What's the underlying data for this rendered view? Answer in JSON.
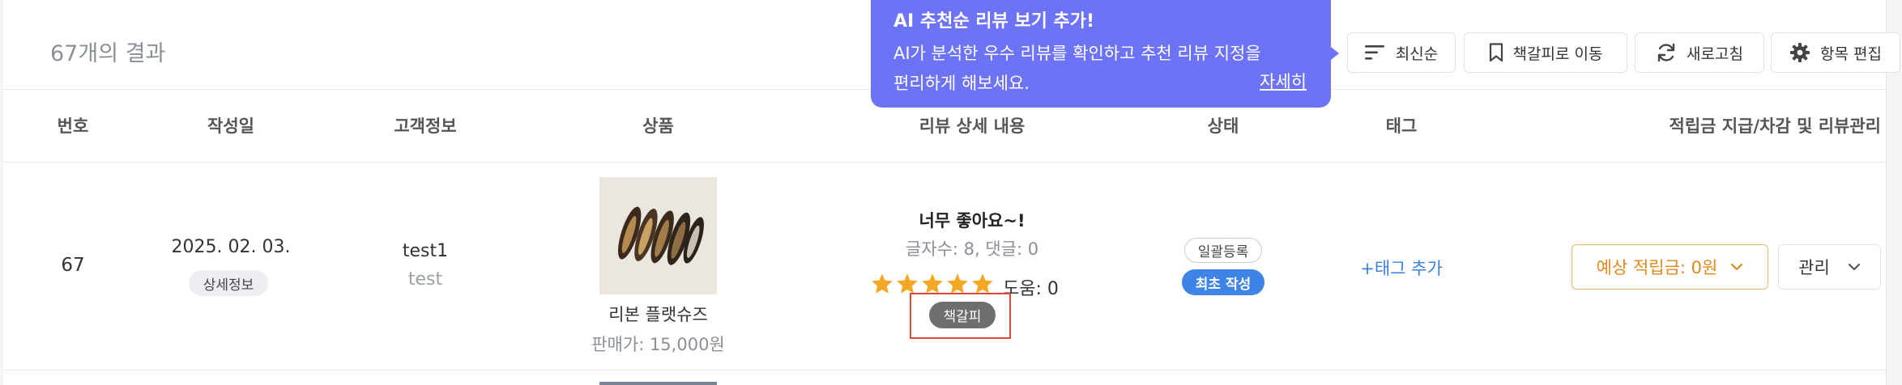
{
  "result_count": "67개의 결과",
  "tooltip": {
    "title": "AI 추천순 리뷰 보기 추가!",
    "body_line1": "AI가 분석한 우수 리뷰를 확인하고 추천 리뷰 지정을",
    "body_line2": "편리하게 해보세요.",
    "more_link": "자세히"
  },
  "toolbar": {
    "sort_label": "최신순",
    "bookmark_label": "책갈피로 이동",
    "refresh_label": "새로고침",
    "edit_columns_label": "항목 편집"
  },
  "table": {
    "headers": {
      "number": "번호",
      "date": "작성일",
      "customer": "고객정보",
      "product": "상품",
      "review": "리뷰 상세 내용",
      "status": "상태",
      "tag": "태그",
      "reward": "적립금 지급/차감 및 리뷰관리"
    },
    "row": {
      "number": "67",
      "date": "2025. 02. 03.",
      "detail_chip": "상세정보",
      "customer_id": "test1",
      "customer_name": "test",
      "product_name": "리본 플랫슈즈",
      "product_price": "판매가: 15,000원",
      "review_title": "너무 좋아요~!",
      "review_meta": "글자수: 8, 댓글: 0",
      "rating": 5,
      "helpful": "도움: 0",
      "bookmark_chip": "책갈피",
      "status_bulk": "일괄등록",
      "status_first": "최초 작성",
      "tag_add": "+태그 추가",
      "reward_select": "예상 적립금: 0원",
      "manage_select": "관리"
    }
  },
  "colors": {
    "tooltip_bg": "#6c73f5",
    "star": "#f5a623",
    "reward_text": "#e08a1e",
    "status_first_bg": "#3d84e6",
    "tag_link": "#3d7fe0",
    "bookmark_highlight": "#e0483a"
  }
}
